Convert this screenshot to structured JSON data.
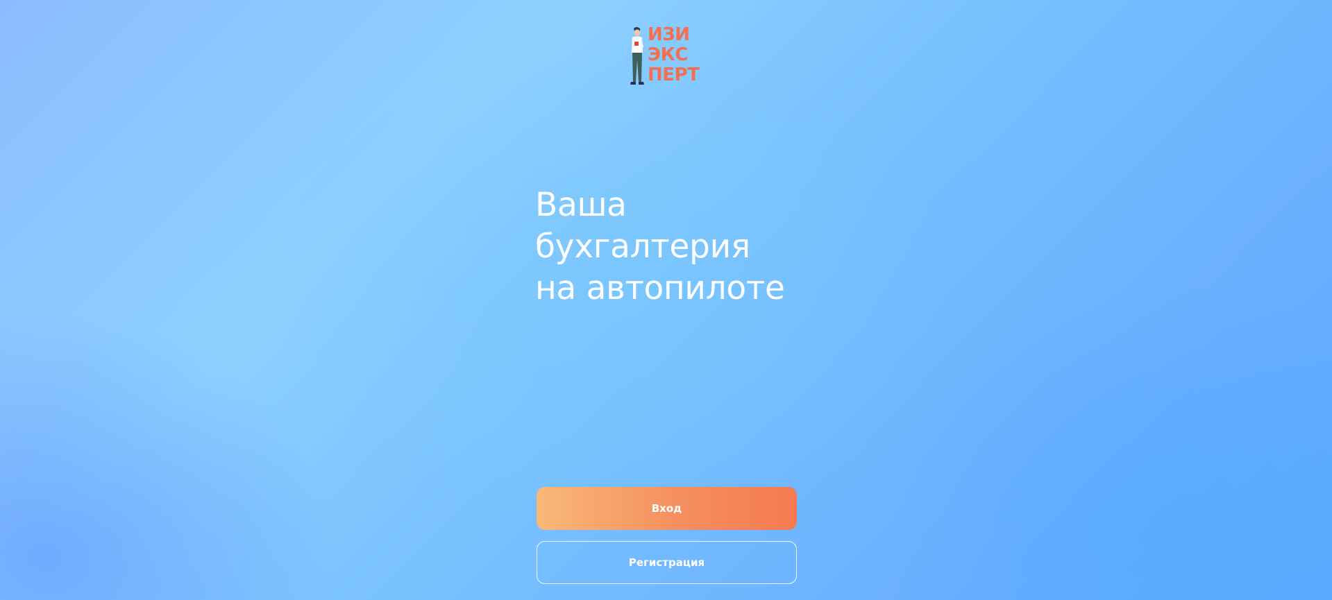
{
  "logo": {
    "line1": "ИЗИ",
    "line2": "ЭКС",
    "line3": "ПЕРТ"
  },
  "hero": {
    "line1": "Ваша",
    "line2": "бухгалтерия",
    "line3": "на автопилоте"
  },
  "actions": {
    "login_label": "Вход",
    "register_label": "Регистрация"
  },
  "colors": {
    "brand_orange": "#f26f4f",
    "login_gradient_start": "#f9b87a",
    "login_gradient_end": "#f57a52",
    "background_blue": "#76bfff"
  }
}
